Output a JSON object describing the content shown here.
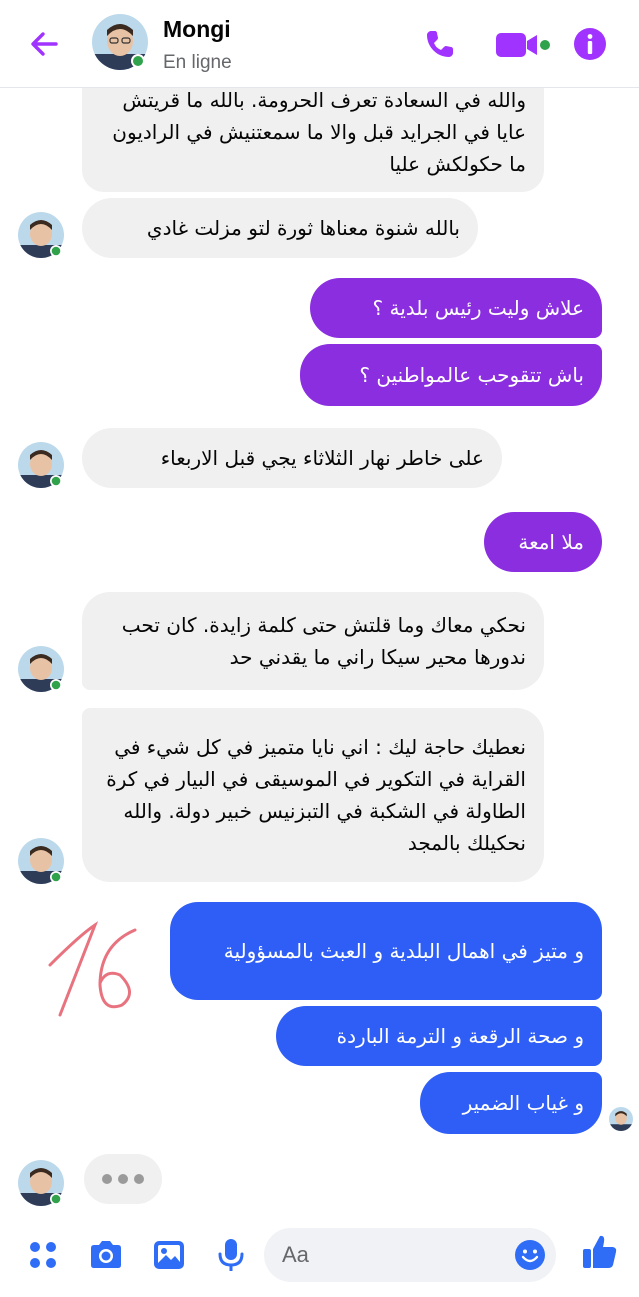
{
  "header": {
    "name": "Mongi",
    "status": "En ligne"
  },
  "colors": {
    "accent": "#a033ff",
    "incoming": "#f0f0f0",
    "outgoing_purple": "#8a2ee0",
    "outgoing_blue": "#2f5ef6",
    "online": "#31a24c"
  },
  "messages": [
    {
      "from": "contact",
      "text": "والله في السعادة تعرف الحرومة. بالله ما قريتش عايا في الجرايد قبل والا ما سمعتنيش في الراديون ما حكولكش عليا"
    },
    {
      "from": "contact",
      "text": "بالله شنوة معناها ثورة لتو مزلت غادي"
    },
    {
      "from": "me",
      "text": "علاش وليت رئيس بلدية ؟"
    },
    {
      "from": "me",
      "text": "باش تتقوحب عالمواطنين ؟"
    },
    {
      "from": "contact",
      "text": "على خاطر نهار الثلاثاء يجي قبل الاربعاء"
    },
    {
      "from": "me",
      "text": "ملا امعة"
    },
    {
      "from": "contact",
      "text": "نحكي معاك وما قلتش حتى كلمة زايدة. كان تحب ندورها محير سيكا راني ما يقدني حد"
    },
    {
      "from": "contact",
      "text": "نعطيك حاجة ليك : اني نايا متميز في كل شيء في القراية في التكوير في الموسيقى في البيار في كرة الطاولة في الشكبة في التبزنيس خبير دولة. والله نحكيلك بالمجد"
    },
    {
      "from": "me",
      "text": "و متيز في اهمال البلدية و العبث بالمسؤولية"
    },
    {
      "from": "me",
      "text": "و صحة الرقعة و الترمة الباردة"
    },
    {
      "from": "me",
      "text": "و غياب الضمير"
    }
  ],
  "annotation": "16",
  "composer": {
    "placeholder": "Aa"
  },
  "icons": [
    "back-arrow-icon",
    "phone-icon",
    "video-icon",
    "info-icon",
    "menu-dots-icon",
    "camera-icon",
    "gallery-icon",
    "microphone-icon",
    "emoji-icon",
    "like-icon"
  ]
}
